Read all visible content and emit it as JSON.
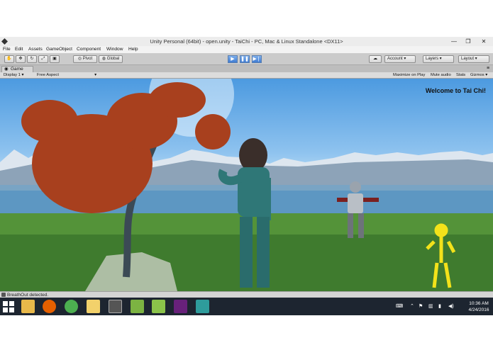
{
  "window": {
    "title": "Unity Personal (64bit) - open.unity - TaiChi - PC, Mac & Linux Standalone <DX11>",
    "minimize": "—",
    "maximize": "❐",
    "close": "✕"
  },
  "menu": [
    "File",
    "Edit",
    "Assets",
    "GameObject",
    "Component",
    "Window",
    "Help"
  ],
  "toolbar": {
    "pivot": "Pivot",
    "global": "Global",
    "account": "Account",
    "layers": "Layers",
    "layout": "Layout"
  },
  "tab": {
    "label": "Game"
  },
  "gamebar": {
    "display": "Display 1",
    "aspect": "Free Aspect",
    "maximize_on_play": "Maximize on Play",
    "mute_audio": "Mute audio",
    "stats": "Stats",
    "gizmos": "Gizmos"
  },
  "game": {
    "welcome": "Welcome to Tai Chi!"
  },
  "status": {
    "message": "BreathOut detected."
  },
  "taskbar": {
    "time": "10:36 AM",
    "date": "4/24/2016",
    "colors": {
      "background": "#1d2530",
      "windows": "#ffffff",
      "files": "#e8b84a",
      "firefox": "#e66000",
      "chrome": "#4caf50",
      "explorer": "#f2d16b",
      "unity": "#333333",
      "minecraft": "#7cb342",
      "vs": "#68217a",
      "app": "#2e9c9c"
    }
  }
}
